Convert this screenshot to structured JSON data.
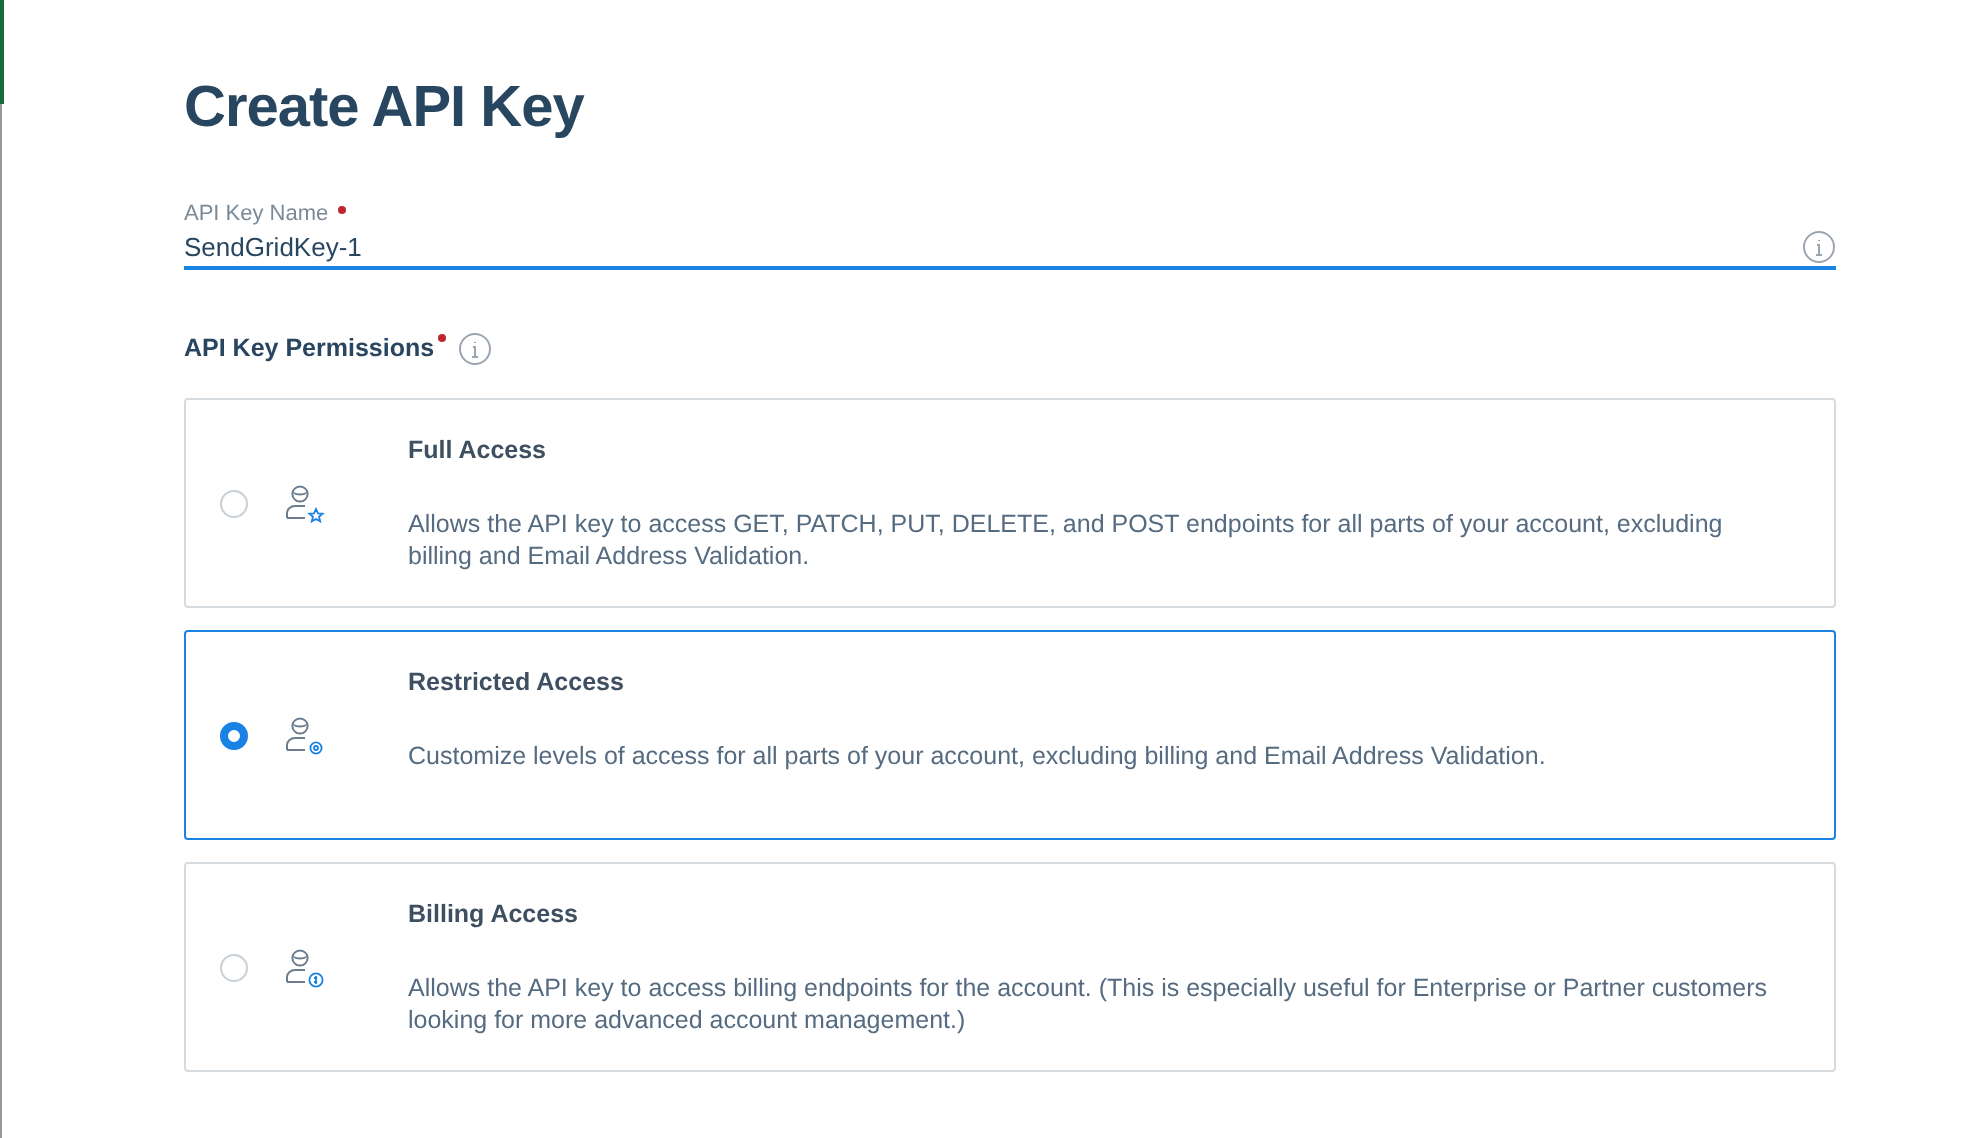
{
  "title": "Create API Key",
  "name_field": {
    "label": "API Key Name",
    "required": true,
    "value": "SendGridKey-1",
    "focused": true
  },
  "permissions": {
    "label": "API Key Permissions",
    "required": true,
    "options": [
      {
        "kind": "star",
        "title": "Full Access",
        "description": "Allows the API key to access GET, PATCH, PUT, DELETE, and POST endpoints for all parts of your account, excluding billing and Email Address Validation.",
        "selected": false
      },
      {
        "kind": "gear",
        "title": "Restricted Access",
        "description": "Customize levels of access for all parts of your account, excluding billing and Email Address Validation.",
        "selected": true
      },
      {
        "kind": "dollar",
        "title": "Billing Access",
        "description": "Allows the API key to access billing endpoints for the account. (This is especially useful for Enterprise or Partner customers looking for more advanced account management.)",
        "selected": false
      }
    ]
  }
}
